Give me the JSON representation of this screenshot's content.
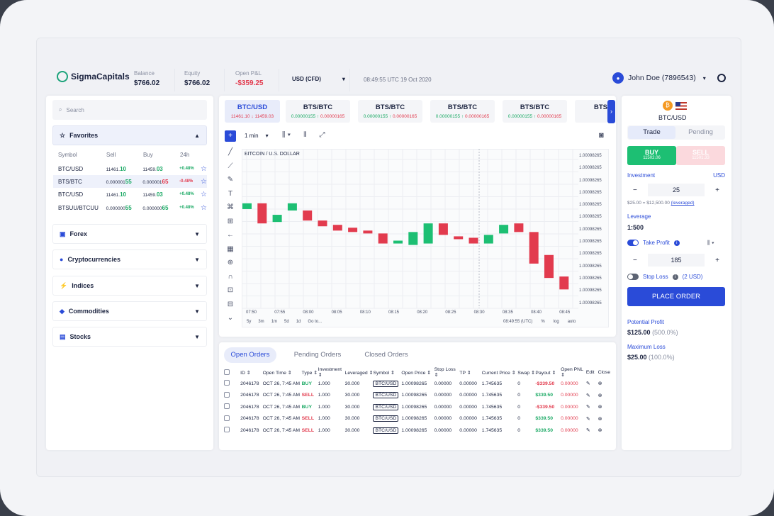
{
  "header": {
    "logo": "SigmaCapitals",
    "balance_label": "Balance",
    "balance_value": "$766.02",
    "equity_label": "Equity",
    "equity_value": "$766.02",
    "pnl_label": "Open P&L",
    "pnl_value": "-$359.25",
    "currency": "USD (CFD)",
    "datetime": "08:49:55 UTC 19 Oct 2020",
    "user": "John Doe (7896543)"
  },
  "left": {
    "search_placeholder": "Search",
    "favorites_label": "Favorites",
    "cols": [
      "Symbol",
      "Sell",
      "Buy",
      "24h"
    ],
    "rows": [
      {
        "symbol": "BTC/USD",
        "sell_a": "11461.",
        "sell_b": "10",
        "buy_a": "11459.",
        "buy_b": "03",
        "chg": "+0.48%"
      },
      {
        "symbol": "BTS/BTC",
        "sell_a": "0.000001",
        "sell_b": "55",
        "buy_a": "0.000001",
        "buy_b": "65",
        "chg": "-0.48%"
      },
      {
        "symbol": "BTC/USD",
        "sell_a": "11461.",
        "sell_b": "10",
        "buy_a": "11459.",
        "buy_b": "03",
        "chg": "+0.48%"
      },
      {
        "symbol": "BTSUU/BTCUU",
        "sell_a": "0.000000",
        "sell_b": "55",
        "buy_a": "0.000000",
        "buy_b": "65",
        "chg": "+0.48%"
      }
    ],
    "categories": [
      "Forex",
      "Cryptocurrencies",
      "Indices",
      "Commodities",
      "Stocks"
    ]
  },
  "tickers": [
    {
      "name": "BTC/USD",
      "sell": "11461.10",
      "buy": "11459.03"
    },
    {
      "name": "BTS/BTC",
      "sell": "0.00000155",
      "buy": "0.00000165"
    },
    {
      "name": "BTS/BTC",
      "sell": "0.00000155",
      "buy": "0.00000165"
    },
    {
      "name": "BTS/BTC",
      "sell": "0.00000155",
      "buy": "0.00000165"
    },
    {
      "name": "BTS/BTC",
      "sell": "0.00000155",
      "buy": "0.00000165"
    },
    {
      "name": "BTS",
      "sell": "",
      "buy": ""
    }
  ],
  "chart": {
    "interval": "1 min",
    "title": "BITCOIN / U.S. DOLLAR",
    "y_label": "1.00098265",
    "x_ticks": [
      "07:50",
      "07:55",
      "08:00",
      "08:05",
      "08:10",
      "08:15",
      "08:20",
      "08:25",
      "08:30",
      "08:35",
      "08:40",
      "08:45"
    ],
    "ranges": [
      "5y",
      "3m",
      "1m",
      "5d",
      "1d",
      "Go to..."
    ],
    "bottom_time": "08:49:55 (UTC)",
    "bottom_opts": [
      "%",
      "log",
      "auto"
    ]
  },
  "chart_data": {
    "type": "candlestick",
    "title": "BITCOIN / U.S. DOLLAR",
    "x": [
      "07:50",
      "07:52",
      "07:54",
      "07:56",
      "07:58",
      "08:00",
      "08:02",
      "08:04",
      "08:06",
      "08:08",
      "08:10",
      "08:12",
      "08:14",
      "08:16",
      "08:18",
      "08:20",
      "08:22",
      "08:24",
      "08:26",
      "08:28",
      "08:30",
      "08:32",
      "08:34"
    ],
    "candles": [
      {
        "o": 0.62,
        "c": 0.66,
        "up": true
      },
      {
        "o": 0.66,
        "c": 0.52,
        "up": false
      },
      {
        "o": 0.53,
        "c": 0.58,
        "up": true
      },
      {
        "o": 0.61,
        "c": 0.66,
        "up": true
      },
      {
        "o": 0.61,
        "c": 0.54,
        "up": false
      },
      {
        "o": 0.54,
        "c": 0.5,
        "up": false
      },
      {
        "o": 0.51,
        "c": 0.47,
        "up": false
      },
      {
        "o": 0.49,
        "c": 0.46,
        "up": false
      },
      {
        "o": 0.47,
        "c": 0.45,
        "up": false
      },
      {
        "o": 0.45,
        "c": 0.38,
        "up": false
      },
      {
        "o": 0.38,
        "c": 0.4,
        "up": true
      },
      {
        "o": 0.37,
        "c": 0.46,
        "up": true
      },
      {
        "o": 0.52,
        "c": 0.38,
        "up": true
      },
      {
        "o": 0.52,
        "c": 0.44,
        "up": false
      },
      {
        "o": 0.43,
        "c": 0.41,
        "up": false
      },
      {
        "o": 0.42,
        "c": 0.38,
        "up": false
      },
      {
        "o": 0.38,
        "c": 0.44,
        "up": true
      },
      {
        "o": 0.45,
        "c": 0.51,
        "up": true
      },
      {
        "o": 0.52,
        "c": 0.46,
        "up": false
      },
      {
        "o": 0.46,
        "c": 0.24,
        "up": false
      },
      {
        "o": 0.3,
        "c": 0.14,
        "up": false
      },
      {
        "o": 0.15,
        "c": 0.06,
        "up": false
      }
    ]
  },
  "right": {
    "symbol": "BTC/USD",
    "tab_trade": "Trade",
    "tab_pending": "Pending",
    "buy_label": "BUY",
    "buy_price": "11502.06",
    "sell_label": "SELL",
    "sell_price": "11501.33",
    "investment_label": "Investment",
    "investment_unit": "USD",
    "investment_value": "25",
    "investment_note": "$25.00 = $12,500.00",
    "leveraged": "(leveraged)",
    "leverage_label": "Leverage",
    "leverage_value": "1:500",
    "tp_label": "Take Profit",
    "tp_value": "185",
    "sl_label": "Stop Loss",
    "sl_note": "(2 USD)",
    "place_order": "PLACE ORDER",
    "pp_label": "Potential Profit",
    "pp_value": "$125.00",
    "pp_pct": "(500.0%)",
    "ml_label": "Maximum Loss",
    "ml_value": "$25.00",
    "ml_pct": "(100.0%)"
  },
  "orders": {
    "tabs": [
      "Open Orders",
      "Pending Orders",
      "Closed Orders"
    ],
    "headers": [
      "ID",
      "Open Time",
      "Type",
      "Investment",
      "Leveraged",
      "Symbol",
      "Open Price",
      "Stop Loss",
      "TP",
      "Current Price",
      "Swap",
      "Payout",
      "Open PNL",
      "Edit",
      "Close"
    ],
    "rows": [
      [
        "2046178",
        "OCT 26, 7:45 AM",
        "BUY",
        "1.000",
        "30.000",
        "BTC/USD",
        "1.00098265",
        "0.00000",
        "0.00000",
        "1.745635",
        "0",
        "-$339.50",
        "0.00000"
      ],
      [
        "2046178",
        "OCT 26, 7:45 AM",
        "SELL",
        "1.000",
        "30.000",
        "BTC/USD",
        "1.00098265",
        "0.00000",
        "0.00000",
        "1.745635",
        "0",
        "$339.50",
        "0.00000"
      ],
      [
        "2046178",
        "OCT 26, 7:45 AM",
        "BUY",
        "1.000",
        "30.000",
        "BTC/USD",
        "1.00098265",
        "0.00000",
        "0.00000",
        "1.745635",
        "0",
        "-$339.50",
        "0.00000"
      ],
      [
        "2046178",
        "OCT 26, 7:45 AM",
        "SELL",
        "1.000",
        "30.000",
        "BTC/USD",
        "1.00098265",
        "0.00000",
        "0.00000",
        "1.745635",
        "0",
        "$339.50",
        "0.00000"
      ],
      [
        "2046178",
        "OCT 26, 7:45 AM",
        "SELL",
        "1.000",
        "30.000",
        "BTC/USD",
        "1.00098265",
        "0.00000",
        "0.00000",
        "1.745635",
        "0",
        "$339.50",
        "0.00000"
      ]
    ]
  },
  "colors": {
    "accent": "#2a4bd8",
    "up": "#1dbf73",
    "down": "#e23b4e"
  }
}
